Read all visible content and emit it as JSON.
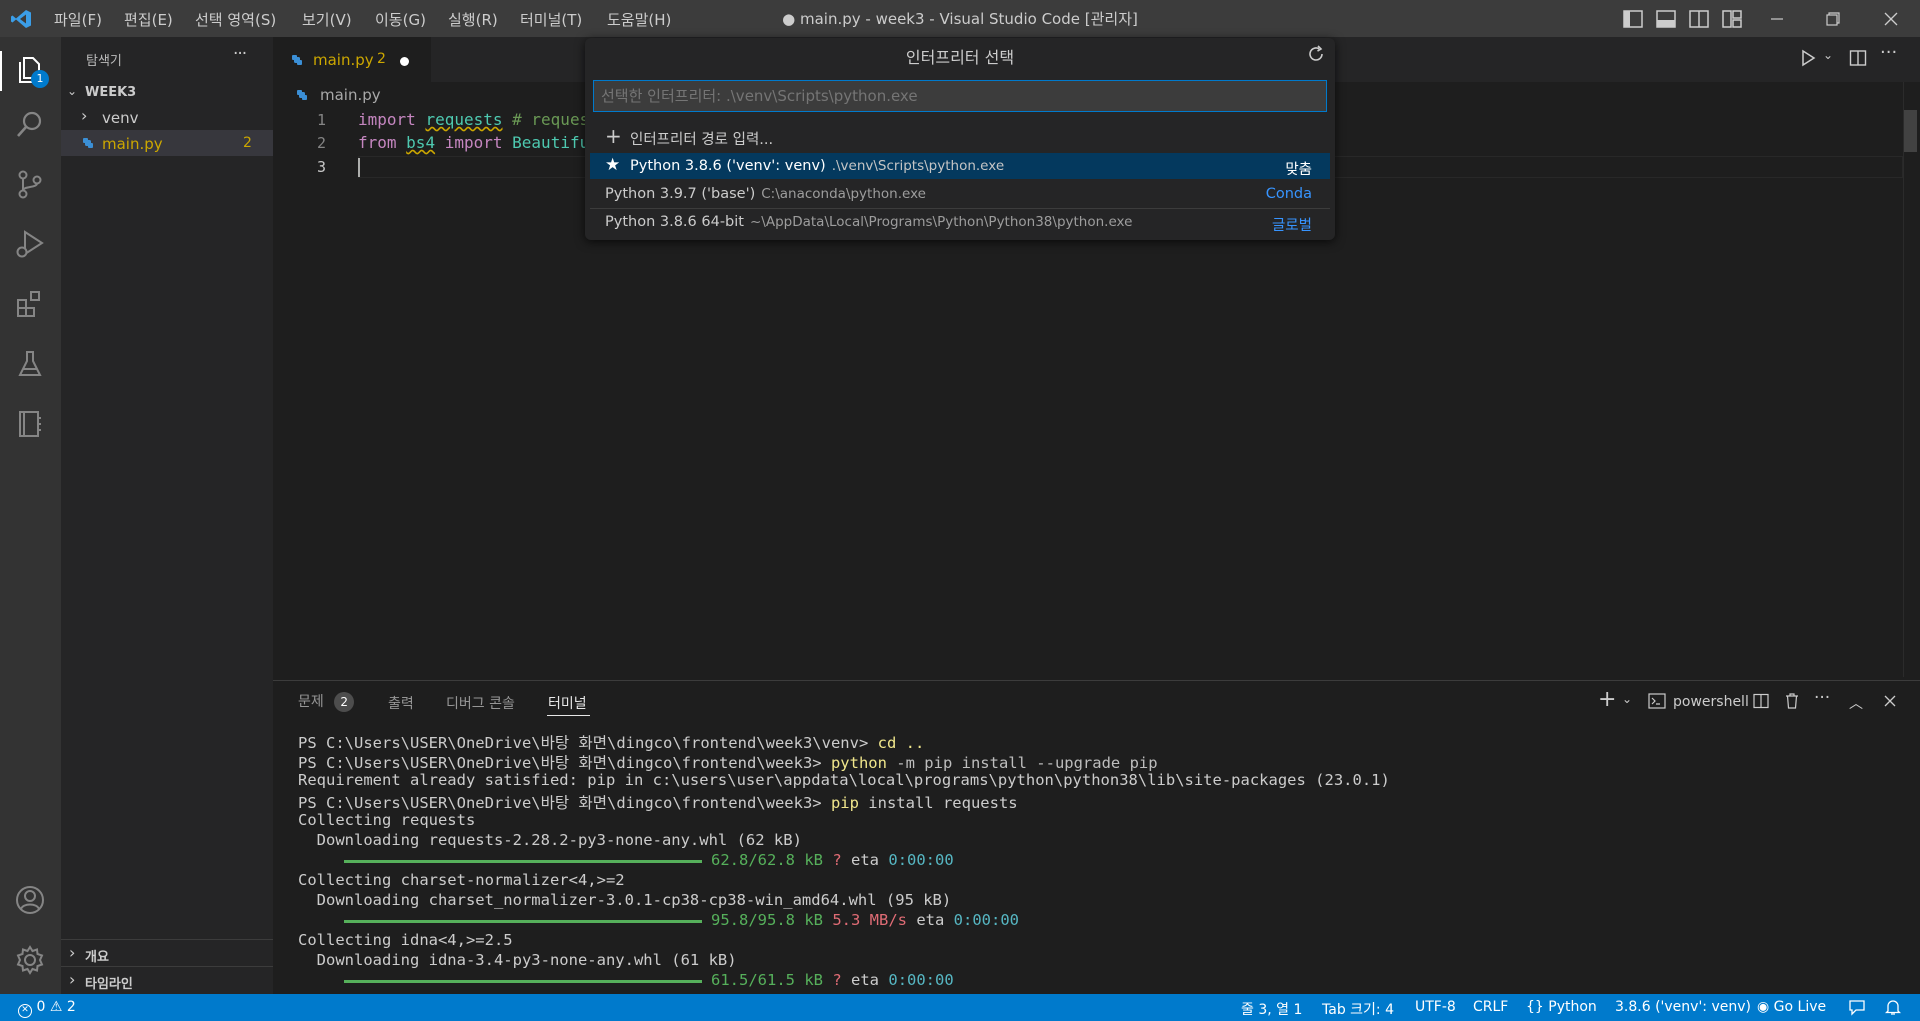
{
  "window": {
    "title": "● main.py - week3 - Visual Studio Code [관리자]",
    "menus": [
      "파일(F)",
      "편집(E)",
      "선택 영역(S)",
      "보기(V)",
      "이동(G)",
      "실행(R)",
      "터미널(T)",
      "도움말(H)"
    ]
  },
  "activity_bar": {
    "explorer_badge": "1"
  },
  "sidebar": {
    "header": "탐색기",
    "more": "···",
    "root": "WEEK3",
    "items": [
      {
        "label": "venv"
      },
      {
        "label": "main.py",
        "badge": "2"
      }
    ],
    "sections": [
      "개요",
      "타임라인"
    ]
  },
  "editor": {
    "tab_label": "main.py",
    "tab_badge": "2",
    "breadcrumb": "main.py",
    "line_numbers": [
      "1",
      "2",
      "3"
    ],
    "line1": {
      "kw": "import",
      "mod": "requests",
      "comment": "# reques"
    },
    "line2": {
      "kw1": "from",
      "mod": "bs4",
      "kw2": "import",
      "name": "Beautiful"
    }
  },
  "quick_pick": {
    "title": "인터프리터 선택",
    "input_placeholder": "선택한 인터프리터: .\\venv\\Scripts\\python.exe",
    "enter_path": "인터프리터 경로 입력...",
    "items": [
      {
        "label": "Python 3.8.6 ('venv': venv)",
        "desc": ".\\venv\\Scripts\\python.exe",
        "tag": "맞춤"
      },
      {
        "label": "Python 3.9.7 ('base')",
        "desc": "C:\\anaconda\\python.exe",
        "tag": "Conda"
      },
      {
        "label": "Python 3.8.6 64-bit",
        "desc": "~\\AppData\\Local\\Programs\\Python\\Python38\\python.exe",
        "tag": "글로벌"
      }
    ]
  },
  "panel": {
    "tabs": [
      "문제",
      "출력",
      "디버그 콘솔",
      "터미널"
    ],
    "problems_count": "2",
    "shell": "powershell",
    "terminal": {
      "l1_prompt": "PS C:\\Users\\USER\\OneDrive\\바탕 화면\\dingco\\frontend\\week3\\venv> ",
      "l1_cmd": "cd ..",
      "l2_prompt": "PS C:\\Users\\USER\\OneDrive\\바탕 화면\\dingco\\frontend\\week3> ",
      "l2_cmd": "python",
      "l2_args": " -m pip install --upgrade pip",
      "l3": "Requirement already satisfied: pip in c:\\users\\user\\appdata\\local\\programs\\python\\python38\\lib\\site-packages (23.0.1)",
      "l4_prompt": "PS C:\\Users\\USER\\OneDrive\\바탕 화면\\dingco\\frontend\\week3> ",
      "l4_cmd": "pip",
      "l4_args": " install requests",
      "l5": "Collecting requests",
      "l6": "  Downloading requests-2.28.2-py3-none-any.whl (62 kB)",
      "p1_size": "62.8/62.8 kB",
      "p1_speed": "?",
      "p1_eta": "0:00:00",
      "l8": "Collecting charset-normalizer<4,>=2",
      "l9": "  Downloading charset_normalizer-3.0.1-cp38-cp38-win_amd64.whl (95 kB)",
      "p2_size": "95.8/95.8 kB",
      "p2_speed": "5.3 MB/s",
      "p2_eta": "0:00:00",
      "l11": "Collecting idna<4,>=2.5",
      "l12": "  Downloading idna-3.4-py3-none-any.whl (61 kB)",
      "p3_size": "61.5/61.5 kB",
      "p3_speed": "?",
      "p3_eta": "0:00:00",
      "eta_label": "eta"
    }
  },
  "status_bar": {
    "errors": "0",
    "warnings": "2",
    "position": "줄 3, 열 1",
    "tab_size": "Tab 크기: 4",
    "encoding": "UTF-8",
    "eol": "CRLF",
    "language": "Python",
    "interpreter": "3.8.6 ('venv': venv)",
    "go_live": "Go Live"
  },
  "colors": {
    "accent": "#007acc",
    "selection": "#04395e",
    "keyword": "#c586c0",
    "module": "#4ec9b0",
    "progress": "#56b05b"
  }
}
